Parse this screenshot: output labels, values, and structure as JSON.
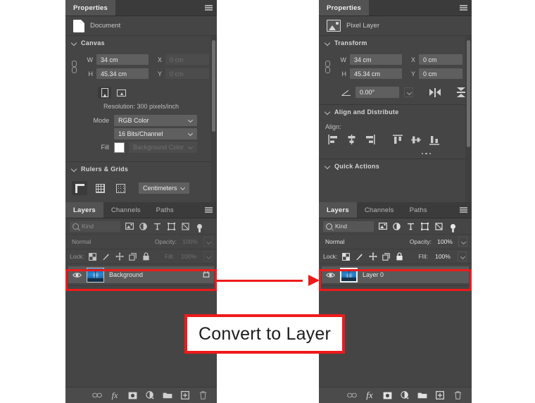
{
  "app": {
    "background": "#ffffff",
    "panel_bg": "#454545",
    "accent_red": "#ef1a1a"
  },
  "caption": {
    "text": "Convert to Layer"
  },
  "arrow": {
    "name": "red-arrow",
    "direction": "right"
  },
  "left": {
    "properties": {
      "tab_label": "Properties",
      "menu_icon": "panel-menu-icon",
      "header": {
        "icon": "document-icon",
        "label": "Document"
      },
      "canvas": {
        "title": "Canvas",
        "link_icon": "link-chain-icon",
        "w_label": "W",
        "w_value": "34 cm",
        "h_label": "H",
        "h_value": "45.34 cm",
        "x_label": "X",
        "x_value": "0 cm",
        "y_label": "Y",
        "y_value": "0 cm",
        "orientation_portrait_icon": "orientation-portrait-icon",
        "orientation_landscape_icon": "orientation-landscape-icon",
        "resolution": "Resolution: 300 pixels/inch",
        "mode_label": "Mode",
        "mode_value": "RGB Color",
        "depth_value": "16 Bits/Channel",
        "fill_label": "Fill",
        "fill_swatch": "#ffffff",
        "fill_value": "Background Color"
      },
      "rulers": {
        "title": "Rulers & Grids",
        "ruler_icon": "ruler-icon",
        "grid_icon": "grid-icon",
        "dots_icon": "dot-grid-icon",
        "units_value": "Centimeters"
      }
    },
    "layers": {
      "tabs": [
        "Layers",
        "Channels",
        "Paths"
      ],
      "active_tab": "Layers",
      "menu_icon": "panel-menu-icon",
      "filter": {
        "search_icon": "search-icon",
        "kind_value": "Kind",
        "icons": [
          "pixel-filter-icon",
          "adjustment-filter-icon",
          "type-filter-icon",
          "shape-filter-icon",
          "smart-object-filter-icon"
        ],
        "toggle_icon": "filter-toggle-icon"
      },
      "blend": {
        "mode_value": "Normal",
        "opacity_label": "Opacity:",
        "opacity_value": "100%"
      },
      "lock": {
        "label": "Lock:",
        "icons": [
          "lock-transparent-pixels-icon",
          "lock-image-pixels-icon",
          "lock-position-icon",
          "lock-artboard-nesting-icon",
          "lock-all-icon"
        ],
        "fill_label": "Fill:",
        "fill_value": "100%"
      },
      "row": {
        "visibility_icon": "eye-icon",
        "thumbnail": "layer-thumbnail",
        "name": "Background",
        "lock_badge_icon": "lock-icon",
        "highlighted": true
      },
      "footer_icons": [
        "link-layers-icon",
        "layer-style-fx-icon",
        "add-layer-mask-icon",
        "new-adjustment-layer-icon",
        "new-group-icon",
        "new-layer-icon",
        "delete-layer-icon"
      ]
    }
  },
  "right": {
    "properties": {
      "tab_label": "Properties",
      "menu_icon": "panel-menu-icon",
      "header": {
        "icon": "pixel-layer-icon",
        "label": "Pixel Layer"
      },
      "transform": {
        "title": "Transform",
        "link_icon": "link-chain-icon",
        "w_label": "W",
        "w_value": "34 cm",
        "h_label": "H",
        "h_value": "45.34 cm",
        "x_label": "X",
        "x_value": "0 cm",
        "y_label": "Y",
        "y_value": "0 cm",
        "angle_icon": "angle-icon",
        "angle_value": "0.00°",
        "flip_horizontal_icon": "flip-horizontal-icon",
        "flip_vertical_icon": "flip-vertical-icon"
      },
      "align": {
        "title": "Align and Distribute",
        "label": "Align:",
        "icons": [
          "align-left-edges-icon",
          "align-horizontal-centers-icon",
          "align-right-edges-icon",
          "align-top-edges-icon",
          "align-vertical-centers-icon",
          "align-bottom-edges-icon"
        ],
        "more_icon": "more-options-icon"
      },
      "quick_actions": {
        "title": "Quick Actions"
      }
    },
    "layers": {
      "tabs": [
        "Layers",
        "Channels",
        "Paths"
      ],
      "active_tab": "Layers",
      "menu_icon": "panel-menu-icon",
      "filter": {
        "search_icon": "search-icon",
        "kind_value": "Kind",
        "icons": [
          "pixel-filter-icon",
          "adjustment-filter-icon",
          "type-filter-icon",
          "shape-filter-icon",
          "smart-object-filter-icon"
        ],
        "toggle_icon": "filter-toggle-icon"
      },
      "blend": {
        "mode_value": "Normal",
        "opacity_label": "Opacity:",
        "opacity_value": "100%"
      },
      "lock": {
        "label": "Lock:",
        "icons": [
          "lock-transparent-pixels-icon",
          "lock-image-pixels-icon",
          "lock-position-icon",
          "lock-artboard-nesting-icon",
          "lock-all-icon"
        ],
        "fill_label": "FIll:",
        "fill_value": "100%"
      },
      "row": {
        "visibility_icon": "eye-icon",
        "thumbnail": "layer-thumbnail",
        "name": "Layer 0",
        "highlighted": true
      },
      "footer_icons": [
        "link-layers-icon",
        "layer-style-fx-icon",
        "add-layer-mask-icon",
        "new-adjustment-layer-icon",
        "new-group-icon",
        "new-layer-icon",
        "delete-layer-icon"
      ]
    }
  }
}
